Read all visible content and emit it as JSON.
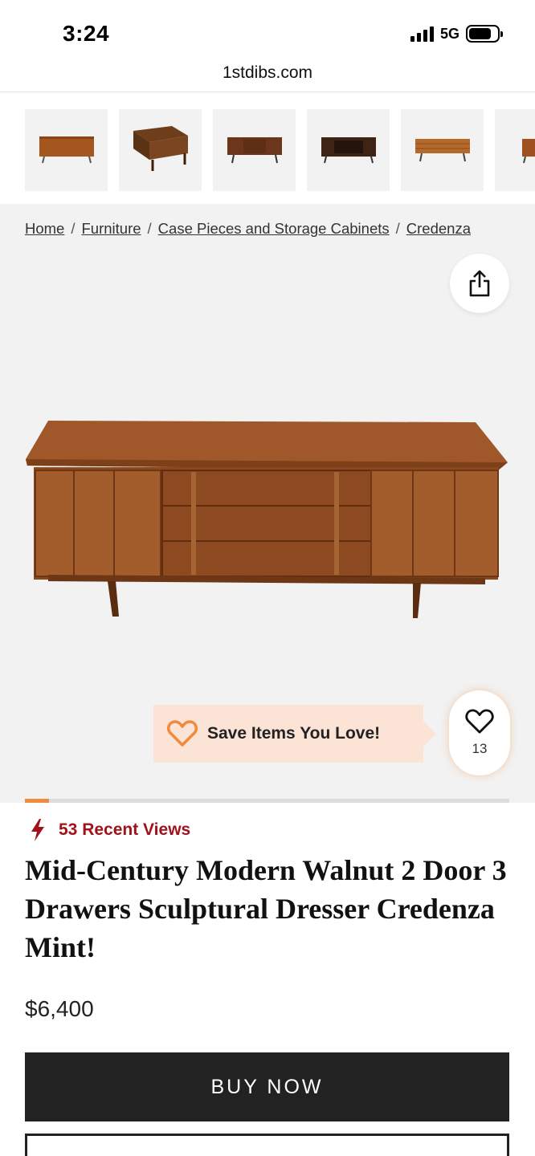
{
  "status_bar": {
    "time": "3:24",
    "network": "5G"
  },
  "browser": {
    "url": "1stdibs.com"
  },
  "thumbnails": [
    {
      "alt": "credenza-thumbnail-1"
    },
    {
      "alt": "credenza-thumbnail-2"
    },
    {
      "alt": "credenza-thumbnail-3"
    },
    {
      "alt": "credenza-thumbnail-4"
    },
    {
      "alt": "credenza-thumbnail-5"
    },
    {
      "alt": "credenza-thumbnail-6"
    }
  ],
  "breadcrumb": {
    "items": [
      "Home",
      "Furniture",
      "Case Pieces and Storage Cabinets",
      "Credenza"
    ],
    "separator": "/"
  },
  "icons": {
    "share": "share-icon",
    "heart": "heart-icon",
    "bolt": "lightning-bolt-icon"
  },
  "gallery": {
    "progress": 0.05
  },
  "save_prompt": {
    "text": "Save Items You Love!"
  },
  "favorite": {
    "count": "13"
  },
  "product": {
    "recent_views": "53 Recent Views",
    "title": "Mid-Century Modern Walnut 2 Door 3 Drawers Sculptural Dresser Credenza Mint!",
    "price": "$6,400",
    "buy_label": "BUY NOW"
  },
  "colors": {
    "accent_orange": "#f08a3c",
    "views_red": "#a0121b",
    "button_dark": "#222222"
  }
}
